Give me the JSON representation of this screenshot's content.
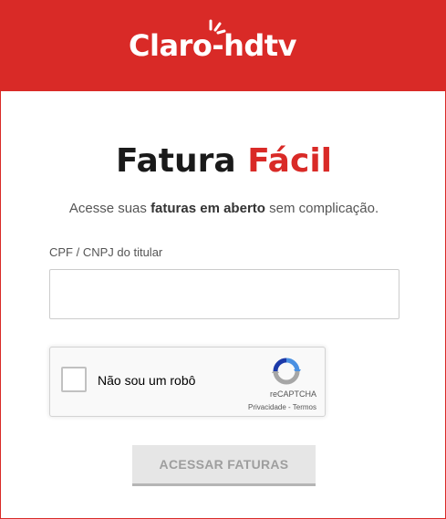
{
  "brand": {
    "logo_text": "Claro-hdtv",
    "color": "#d92a27"
  },
  "page": {
    "title_part1": "Fatura",
    "title_part2": "Fácil",
    "subtitle_before": "Acesse suas",
    "subtitle_bold": "faturas em aberto",
    "subtitle_after": "sem complicação."
  },
  "form": {
    "cpf_label": "CPF / CNPJ do titular",
    "cpf_value": "",
    "cpf_placeholder": ""
  },
  "recaptcha": {
    "checkbox_label": "Não sou um robô",
    "checked": false,
    "brand": "reCAPTCHA",
    "privacy": "Privacidade",
    "separator": " - ",
    "terms": "Termos",
    "icon": "recaptcha-icon"
  },
  "submit": {
    "label": "ACESSAR FATURAS",
    "enabled": false
  }
}
